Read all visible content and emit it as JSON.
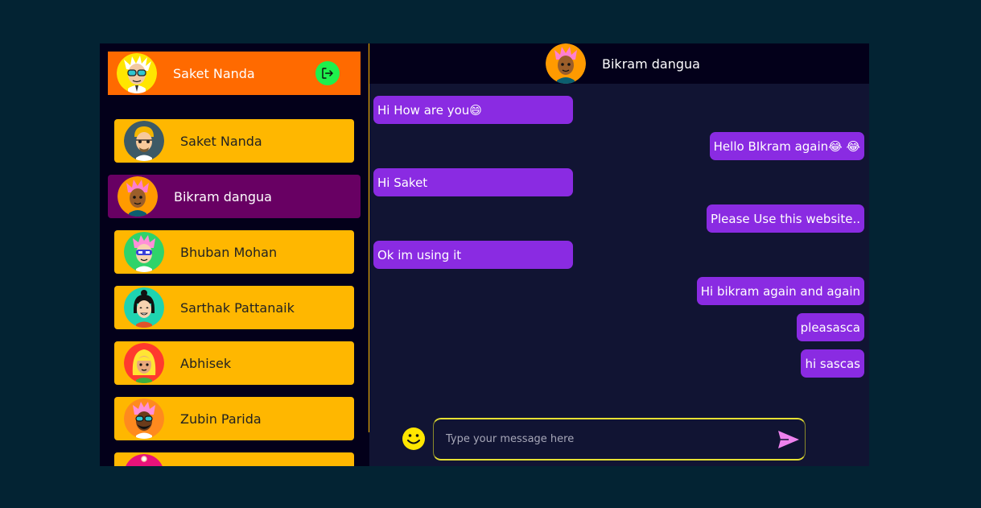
{
  "current_user": {
    "name": "Saket Nanda"
  },
  "contacts": [
    {
      "name": "Saket Nanda"
    },
    {
      "name": "Bikram dangua"
    },
    {
      "name": "Bhuban Mohan"
    },
    {
      "name": "Sarthak Pattanaik"
    },
    {
      "name": "Abhisek"
    },
    {
      "name": "Zubin Parida"
    }
  ],
  "chat": {
    "recipient": "Bikram dangua",
    "messages": [
      {
        "dir": "in",
        "text": "Hi How are you😄"
      },
      {
        "dir": "out",
        "text": "Hello BIkram again😂 😂"
      },
      {
        "dir": "in",
        "text": "Hi Saket"
      },
      {
        "dir": "out",
        "text": "Please Use this website.."
      },
      {
        "dir": "in",
        "text": "Ok im using it"
      },
      {
        "dir": "out",
        "text": "Hi bikram again and again"
      },
      {
        "dir": "out",
        "text": "pleasasca"
      },
      {
        "dir": "out",
        "text": "hi sascas"
      }
    ]
  },
  "composer": {
    "placeholder": "Type your message here",
    "value": ""
  },
  "icons": {
    "logout": "logout-icon",
    "emoji": "smiley-icon",
    "send": "send-icon"
  },
  "colors": {
    "page_bg": "#032333",
    "app_bg": "#03001a",
    "chat_bg": "#111433",
    "current_user_bar": "#ff6a00",
    "contact_bg": "#ffb700",
    "active_contact_bg": "#680063",
    "message_bubble": "#8a2be2",
    "logout_button": "#1ef04c",
    "input_border": "#e6e033",
    "send_icon": "#ee82ee"
  }
}
